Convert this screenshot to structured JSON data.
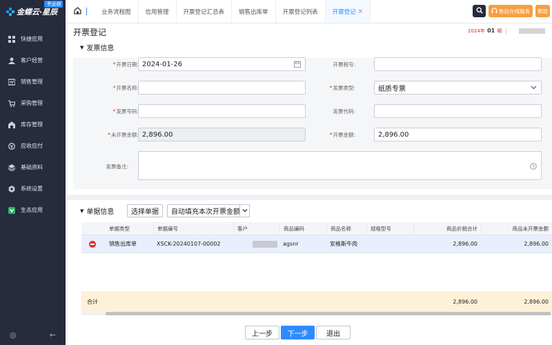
{
  "sidebar": {
    "logo_text": "金蝶云·星辰",
    "logo_badge": "专业版",
    "items": [
      {
        "label": "快捷应用",
        "icon": "grid-icon"
      },
      {
        "label": "客户经营",
        "icon": "user-icon"
      },
      {
        "label": "销售管理",
        "icon": "sales-icon"
      },
      {
        "label": "采购管理",
        "icon": "cart-icon"
      },
      {
        "label": "库存管理",
        "icon": "warehouse-icon"
      },
      {
        "label": "应收应付",
        "icon": "money-icon"
      },
      {
        "label": "基础资料",
        "icon": "layers-icon"
      },
      {
        "label": "系统设置",
        "icon": "settings-icon"
      },
      {
        "label": "生态应用",
        "icon": "apps-icon"
      }
    ]
  },
  "tabs": [
    {
      "label": "业务流程图"
    },
    {
      "label": "信用管理"
    },
    {
      "label": "开票登记汇总表"
    },
    {
      "label": "销售出库单"
    },
    {
      "label": "开票登记列表"
    },
    {
      "label": "开票登记",
      "active": true
    }
  ],
  "topbar": {
    "service_label": "售后在线服务",
    "help_label": "帮助"
  },
  "page": {
    "title": "开票登记",
    "period_year": "2024年",
    "period_num": "01",
    "period_suffix": "期"
  },
  "invoice_section": {
    "title": "发票信息",
    "fields": {
      "invoice_date": {
        "label": "开票日期:",
        "required": true,
        "value": "2024-01-26"
      },
      "tax_no": {
        "label": "开票税号:",
        "required": false,
        "value": ""
      },
      "invoice_name": {
        "label": "开票名称:",
        "required": true,
        "value": ""
      },
      "invoice_type": {
        "label": "发票类型:",
        "required": true,
        "value": "纸质专票"
      },
      "invoice_number": {
        "label": "发票号码:",
        "required": true,
        "value": ""
      },
      "invoice_code": {
        "label": "发票代码:",
        "required": false,
        "value": ""
      },
      "uninvoiced_amount": {
        "label": "未开票金额:",
        "required": true,
        "value": "2,896.00"
      },
      "invoice_amount": {
        "label": "开票金额:",
        "required": true,
        "value": "2,896.00"
      },
      "remark": {
        "label": "发票备注:",
        "required": false,
        "value": ""
      }
    }
  },
  "doc_section": {
    "title": "单据信息",
    "select_button": "选择单据",
    "autofill_button": "自动填充本次开票金额",
    "columns": [
      "单据类型",
      "单据编号",
      "客户",
      "商品编码",
      "商品名称",
      "规格型号",
      "商品价税合计",
      "商品未开票金额"
    ],
    "rows": [
      {
        "doc_type": "销售出库单",
        "doc_no": "XSCK-20240107-00002",
        "customer": "",
        "product_code": "agsnr",
        "product_name": "安格斯牛肉",
        "spec": "",
        "total": "2,896.00",
        "uninvoiced": "2,896.00"
      }
    ],
    "total_label": "合计",
    "total_amount": "2,896.00",
    "total_uninvoiced": "2,896.00"
  },
  "footer": {
    "prev": "上一步",
    "next": "下一步",
    "exit": "退出"
  }
}
